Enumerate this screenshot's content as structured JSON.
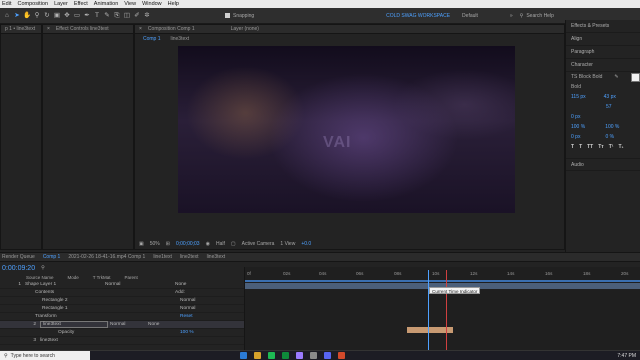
{
  "menu": [
    "Edit",
    "Composition",
    "Layer",
    "Effect",
    "Animation",
    "View",
    "Window",
    "Help"
  ],
  "toolbar": {
    "snapping_label": "Snapping",
    "workspace": "COLD SWAG WORKSPACE",
    "default_label": "Default",
    "search_placeholder": "Search Help"
  },
  "project_panel": {
    "title": "p 1 • line3text"
  },
  "effect_controls": {
    "title": "Effect Controls line3text"
  },
  "composition_panel": {
    "title": "Composition Comp 1",
    "layer_label": "Layer (none)",
    "tabs": [
      "Comp 1",
      "line3text"
    ]
  },
  "viewer_watermark": "VAI",
  "viewer_controls": {
    "zoom": "50%",
    "timecode": "0;00;00;03",
    "resolution": "Half",
    "camera": "Active Camera",
    "views": "1 View",
    "exposure": "+0.0"
  },
  "right_panel": {
    "sections": [
      "Effects & Presets",
      "Align",
      "Paragraph",
      "Character"
    ],
    "font": "TS Block Bold",
    "style": "Bold",
    "size": "115 px",
    "leading": "43 px",
    "tracking": "57",
    "stroke": "0 px",
    "vscale": "100 %",
    "hscale": "100 %",
    "baseline": "0 px",
    "tsume": "0 %",
    "audio": "Audio"
  },
  "timeline": {
    "tabs": [
      "Render Queue",
      "Comp 1",
      "2021-02-26 18-41-16.mp4 Comp 1",
      "line1text",
      "line2text",
      "line3text"
    ],
    "timecode": "0:00:09:20",
    "columns": [
      "Source Name",
      "Mode",
      "T TrkMat",
      "Parent"
    ],
    "rows": [
      {
        "num": "1",
        "name": "Shape Layer 1",
        "mode": "Normal",
        "parent": "None"
      },
      {
        "num": "",
        "name": "Contents",
        "mode": "",
        "parent": "Add:"
      },
      {
        "num": "",
        "name": "Rectangle 2",
        "mode": "Normal",
        "parent": ""
      },
      {
        "num": "",
        "name": "Rectangle 1",
        "mode": "Normal",
        "parent": ""
      },
      {
        "num": "",
        "name": "Transform",
        "mode": "",
        "parent": "Reset"
      },
      {
        "num": "2",
        "name": "line3text",
        "mode": "Normal",
        "parent": "None"
      },
      {
        "num": "",
        "name": "Opacity",
        "mode": "",
        "parent": "100 %"
      },
      {
        "num": "3",
        "name": "line2text",
        "mode": "",
        "parent": ""
      }
    ],
    "ticks": [
      "0f",
      "02s",
      "04s",
      "06s",
      "08s",
      "10s",
      "12s",
      "14s",
      "16s",
      "18s",
      "20s"
    ],
    "tooltip": "Current Time Indicator"
  },
  "taskbar": {
    "search_placeholder": "Type here to search",
    "time": "7:47 PM"
  }
}
